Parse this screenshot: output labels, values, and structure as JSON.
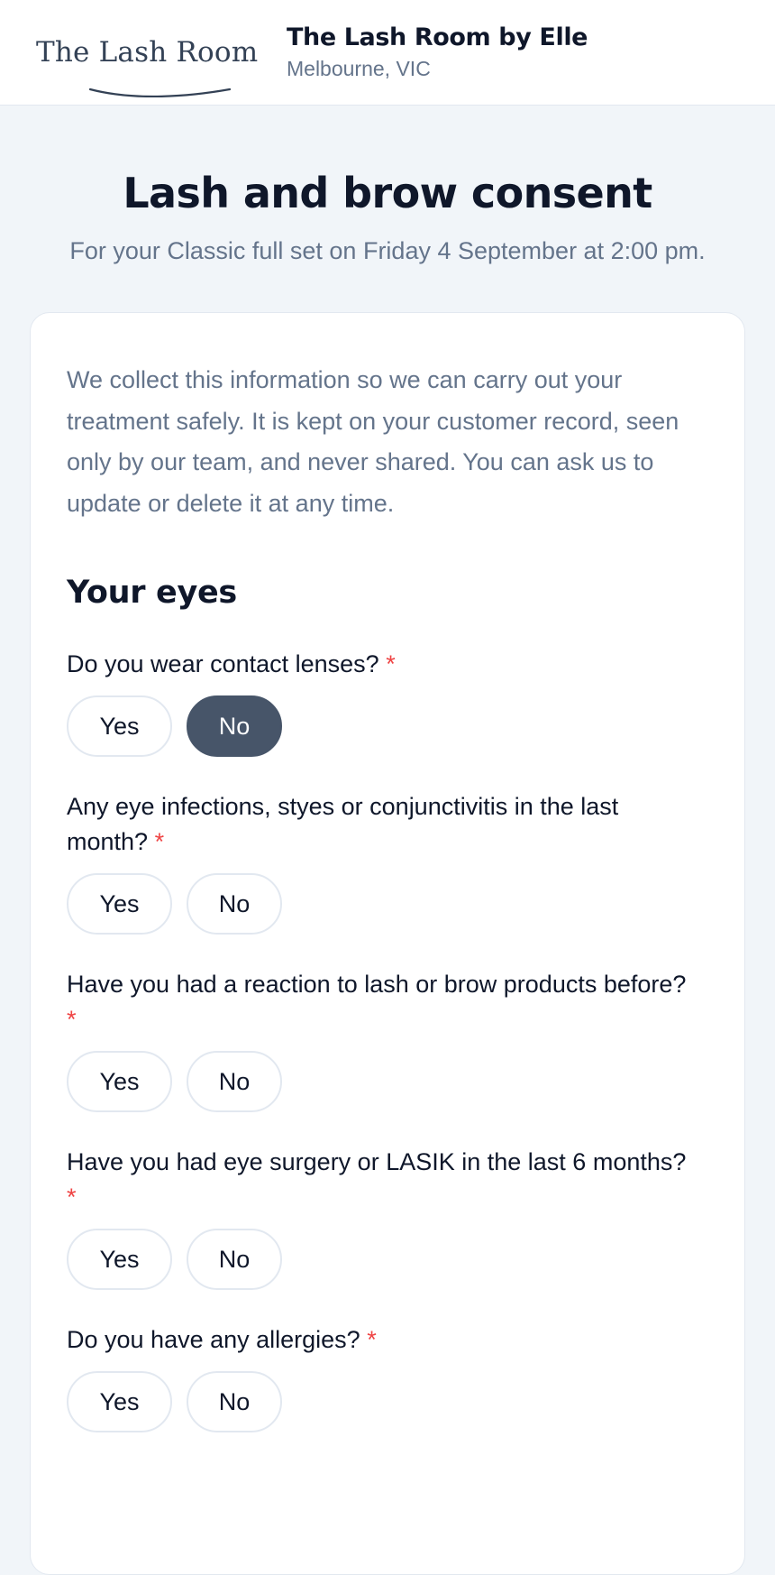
{
  "header": {
    "logo_text": "The Lash Room",
    "business_name": "The Lash Room by Elle",
    "location": "Melbourne, VIC"
  },
  "page": {
    "title": "Lash and brow consent",
    "subtitle": "For your Classic full set on Friday 4 September at 2:00 pm."
  },
  "form": {
    "intro": "We collect this information so we can carry out your treatment safely. It is kept on your customer record, seen only by our team, and never shared. You can ask us to update or delete it at any time.",
    "section_title": "Your eyes",
    "required_marker": "*",
    "questions": [
      {
        "label": "Do you wear contact lenses?",
        "yes": "Yes",
        "no": "No",
        "selected": "No"
      },
      {
        "label": "Any eye infections, styes or conjunctivitis in the last month?",
        "yes": "Yes",
        "no": "No",
        "selected": ""
      },
      {
        "label": "Have you had a reaction to lash or brow products before?",
        "yes": "Yes",
        "no": "No",
        "selected": ""
      },
      {
        "label": "Have you had eye surgery or LASIK in the last 6 months?",
        "yes": "Yes",
        "no": "No",
        "selected": ""
      },
      {
        "label": "Do you have any allergies?",
        "yes": "Yes",
        "no": "No",
        "selected": ""
      }
    ]
  },
  "colors": {
    "selected_bg": "#475569",
    "required": "#ef4444",
    "muted_text": "#64748b"
  }
}
